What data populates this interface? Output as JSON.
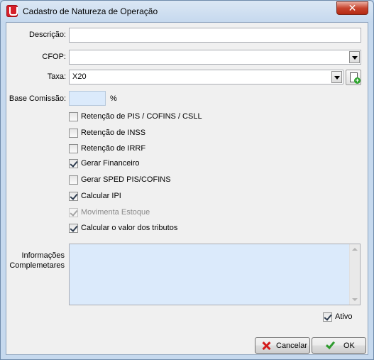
{
  "window": {
    "title": "Cadastro de Natureza de Operação",
    "close_glyph": "✕"
  },
  "form": {
    "descricao": {
      "label": "Descrição:",
      "value": ""
    },
    "cfop": {
      "label": "CFOP:",
      "value": ""
    },
    "taxa": {
      "label": "Taxa:",
      "value": "X20"
    },
    "base_comissao": {
      "label": "Base Comissão:",
      "value": "",
      "unit": "%"
    },
    "informacoes": {
      "label_line1": "Informações",
      "label_line2": "Complemetares",
      "value": ""
    }
  },
  "checkboxes": [
    {
      "label": "Retenção de PIS / COFINS / CSLL",
      "checked": false,
      "enabled": true
    },
    {
      "label": "Retenção de INSS",
      "checked": false,
      "enabled": true
    },
    {
      "label": "Retenção de IRRF",
      "checked": false,
      "enabled": true
    },
    {
      "label": "Gerar Financeiro",
      "checked": true,
      "enabled": true
    },
    {
      "label": "Gerar SPED PIS/COFINS",
      "checked": false,
      "enabled": true
    },
    {
      "label": "Calcular IPI",
      "checked": true,
      "enabled": true
    },
    {
      "label": "Movimenta Estoque",
      "checked": true,
      "enabled": false
    },
    {
      "label": "Calcular o valor dos tributos",
      "checked": true,
      "enabled": true
    }
  ],
  "ativo": {
    "label": "Ativo",
    "checked": true
  },
  "buttons": {
    "cancel_label": "Cancelar",
    "ok_label": "OK"
  },
  "colors": {
    "memo_background": "#dbeafb",
    "close_button": "#c7442e",
    "cancel_icon": "#d31a1a",
    "ok_icon": "#2e9b2e"
  }
}
